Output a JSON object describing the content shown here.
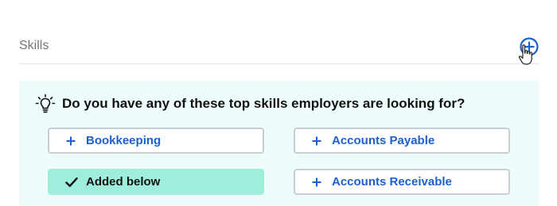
{
  "section": {
    "title": "Skills",
    "add_icon": "plus-circle-icon"
  },
  "suggestions": {
    "prompt": "Do you have any of these top skills employers are looking for?",
    "prompt_icon": "lightbulb-icon",
    "skills": [
      {
        "label": "Bookkeeping",
        "state": "available",
        "icon": "plus-icon"
      },
      {
        "label": "Accounts Payable",
        "state": "available",
        "icon": "plus-icon"
      },
      {
        "label": "Added below",
        "state": "added",
        "icon": "checkmark-icon"
      },
      {
        "label": "Accounts Receivable",
        "state": "available",
        "icon": "plus-icon"
      }
    ]
  },
  "colors": {
    "accent": "#1c5fd1",
    "panel_background": "#effcfc",
    "added_background": "#9feedc",
    "button_border": "#c9ced6",
    "section_title": "#767676"
  }
}
